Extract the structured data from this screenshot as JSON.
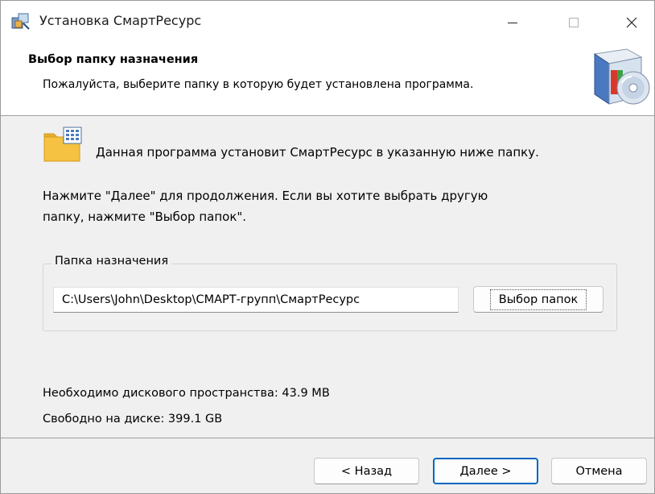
{
  "window": {
    "title": "Установка СмартРесурс",
    "controls": {
      "minimize_icon": "minimize-icon",
      "maximize_icon": "maximize-icon",
      "close_icon": "close-icon"
    }
  },
  "header": {
    "title": "Выбор папку назначения",
    "subtitle": "Пожалуйста, выберите папку в которую будет установлена программа."
  },
  "body": {
    "intro": "Данная программа установит СмартРесурс в указанную ниже папку.",
    "hint_line1": "Нажмите \"Далее\" для продолжения. Если вы хотите выбрать другую",
    "hint_line2": "папку, нажмите \"Выбор папок\".",
    "destination": {
      "group_label": "Папка назначения",
      "path_value": "C:\\Users\\John\\Desktop\\СМАРТ-групп\\СмартРесурс",
      "browse_label": "Выбор папок"
    },
    "space_required": "Необходимо дискового пространства: 43.9 MB",
    "space_free": "Свободно на диске: 399.1 GB"
  },
  "footer": {
    "back_label": "< Назад",
    "next_label": "Далее >",
    "cancel_label": "Отмена"
  },
  "colors": {
    "accent": "#0067c0",
    "folder": "#f5c242",
    "background": "#f0f0f0"
  }
}
